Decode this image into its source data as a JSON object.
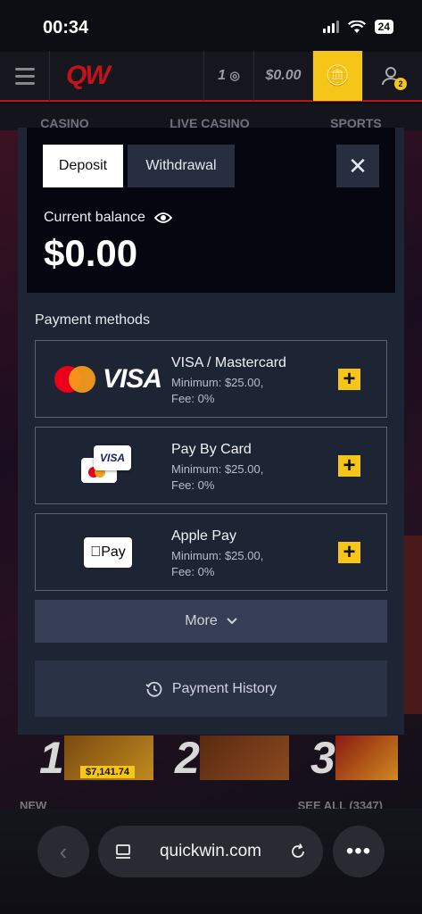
{
  "status_bar": {
    "time": "00:34",
    "battery": "24"
  },
  "site_header": {
    "logo": "QW",
    "level": "1",
    "balance": "$0.00",
    "user_badge": "2",
    "nav": [
      "CASINO",
      "LIVE CASINO",
      "SPORTS"
    ]
  },
  "modal": {
    "tabs": {
      "deposit": "Deposit",
      "withdrawal": "Withdrawal"
    },
    "close": "✕",
    "balance_label": "Current balance",
    "balance_value": "$0.00",
    "payment_methods_title": "Payment methods",
    "methods": [
      {
        "name": "VISA / Mastercard",
        "minimum": "Minimum: $25.00,",
        "fee": "Fee: 0%",
        "logo_text": "VISA"
      },
      {
        "name": "Pay By Card",
        "minimum": "Minimum: $25.00,",
        "fee": "Fee: 0%",
        "logo_text": "VISA"
      },
      {
        "name": "Apple Pay",
        "minimum": "Minimum: $25.00,",
        "fee": "Fee: 0%",
        "logo_text": "Pay"
      }
    ],
    "more_label": "More",
    "history_label": "Payment History"
  },
  "background": {
    "ranks": [
      "1",
      "2",
      "3"
    ],
    "prize": "$7,141.74",
    "new_label": "NEW",
    "see_all": "SEE ALL (3347)"
  },
  "browser": {
    "url": "quickwin.com"
  },
  "colors": {
    "accent_yellow": "#f5c518",
    "modal_bg": "#1d2433",
    "brand_red": "#c0141a"
  }
}
